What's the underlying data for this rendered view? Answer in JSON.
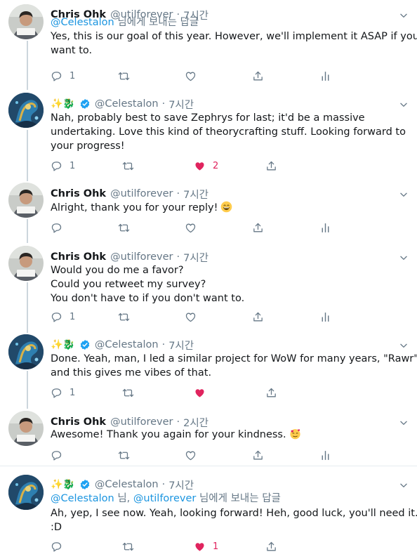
{
  "tweets": [
    {
      "name": "Chris Ohk",
      "handle": "@utilforever",
      "time": "7시간",
      "reply_to_prefix": "",
      "reply_to_mentions": [
        "@Celestalon"
      ],
      "reply_to_suffix": "님에게 보내는 답글",
      "lines": [
        "Yes, this is our goal of this year. However, we'll implement it ASAP if you",
        "want to."
      ],
      "reply_count": "1",
      "like_count": "",
      "liked": false
    },
    {
      "name": "✨🐉",
      "handle": "@Celestalon",
      "time": "7시간",
      "lines": [
        "Nah, probably best to save Zephrys for last; it'd be a massive",
        "undertaking. Love this kind of theorycrafting stuff.  Looking forward to",
        "your progress!"
      ],
      "reply_count": "1",
      "like_count": "2",
      "liked": true
    },
    {
      "name": "Chris Ohk",
      "handle": "@utilforever",
      "time": "7시간",
      "lines": [
        "Alright, thank you for your reply!"
      ],
      "reply_count": "",
      "like_count": "",
      "liked": false
    },
    {
      "name": "Chris Ohk",
      "handle": "@utilforever",
      "time": "7시간",
      "lines": [
        "Would you do me a favor?",
        "Could you retweet my survey?",
        "You don't have to if you don't want to."
      ],
      "reply_count": "1",
      "like_count": "",
      "liked": false
    },
    {
      "name": "✨🐉",
      "handle": "@Celestalon",
      "time": "7시간",
      "lines": [
        "Done. Yeah, man, I led a similar project for WoW for many years, \"Rawr\",",
        "and this gives me vibes of that."
      ],
      "reply_count": "1",
      "like_count": "",
      "liked": true
    },
    {
      "name": "Chris Ohk",
      "handle": "@utilforever",
      "time": "2시간",
      "lines": [
        "Awesome! Thank you again for your kindness."
      ],
      "reply_count": "",
      "like_count": "",
      "liked": false
    },
    {
      "name": "✨🐉",
      "handle": "@Celestalon",
      "time": "7시간",
      "reply_to_mentions": [
        "@Celestalon",
        "@utilforever"
      ],
      "reply_to_joiner": "님,",
      "reply_to_suffix": "님에게 보내는 답글",
      "lines": [
        "Ah, yep, I see now. Yeah, looking forward! Heh, good luck, you'll need it.",
        ":D"
      ],
      "reply_count": "",
      "like_count": "1",
      "liked": true
    }
  ],
  "icons": [
    "reply-icon",
    "retweet-icon",
    "like-icon",
    "share-icon",
    "analytics-icon",
    "verified-icon",
    "caret-down-icon",
    "grinning-emoji",
    "smiling-hearts-emoji"
  ],
  "colors": {
    "accent": "#1b95e0",
    "like": "#e0245e",
    "muted": "#657786",
    "divider": "#e6ecf0",
    "verified": "#1da1f2"
  }
}
